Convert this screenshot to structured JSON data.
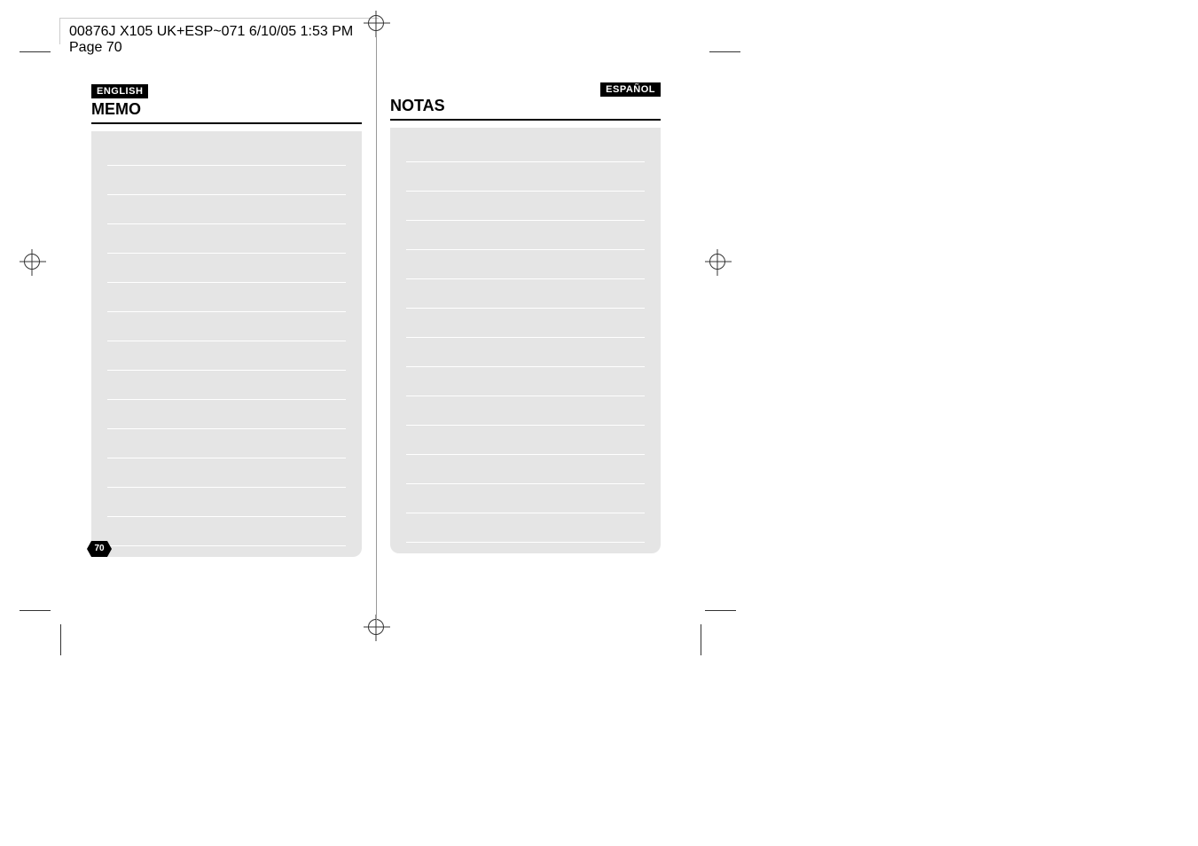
{
  "header": {
    "slug": "00876J X105 UK+ESP~071  6/10/05 1:53 PM  Page 70"
  },
  "leftPage": {
    "langTag": "ENGLISH",
    "title": "MEMO"
  },
  "rightPage": {
    "langTag": "ESPAÑOL",
    "title": "NOTAS"
  },
  "pageNumber": "70",
  "memoLineCount": 14
}
